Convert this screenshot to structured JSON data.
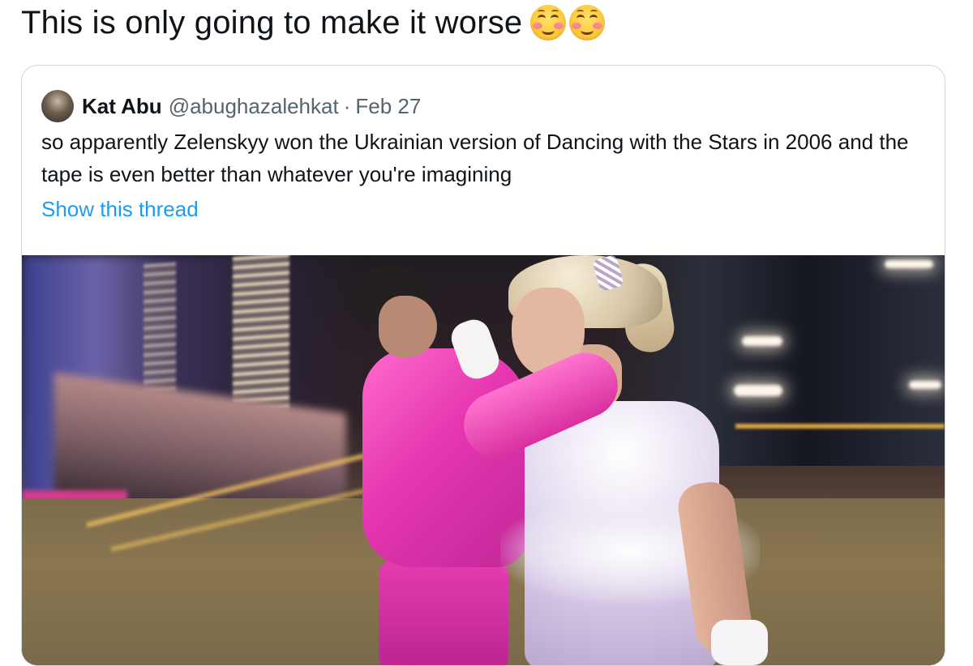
{
  "main_tweet": {
    "text": "This is only going to make it worse",
    "emojis": [
      "smiling-face-with-smiling-eyes",
      "smiling-face-with-smiling-eyes"
    ]
  },
  "quoted_tweet": {
    "author_name": "Kat Abu",
    "author_handle": "@abughazalehkat",
    "separator": "·",
    "date": "Feb 27",
    "text": "so apparently Zelenskyy won the Ukrainian version of Dancing with the Stars in 2006 and the tape is even better than whatever you're imagining",
    "show_thread_label": "Show this thread"
  },
  "colors": {
    "link_blue": "#1d9bf0",
    "text_primary": "#0f1419",
    "text_secondary": "#536471",
    "card_border": "#cfd9de"
  }
}
